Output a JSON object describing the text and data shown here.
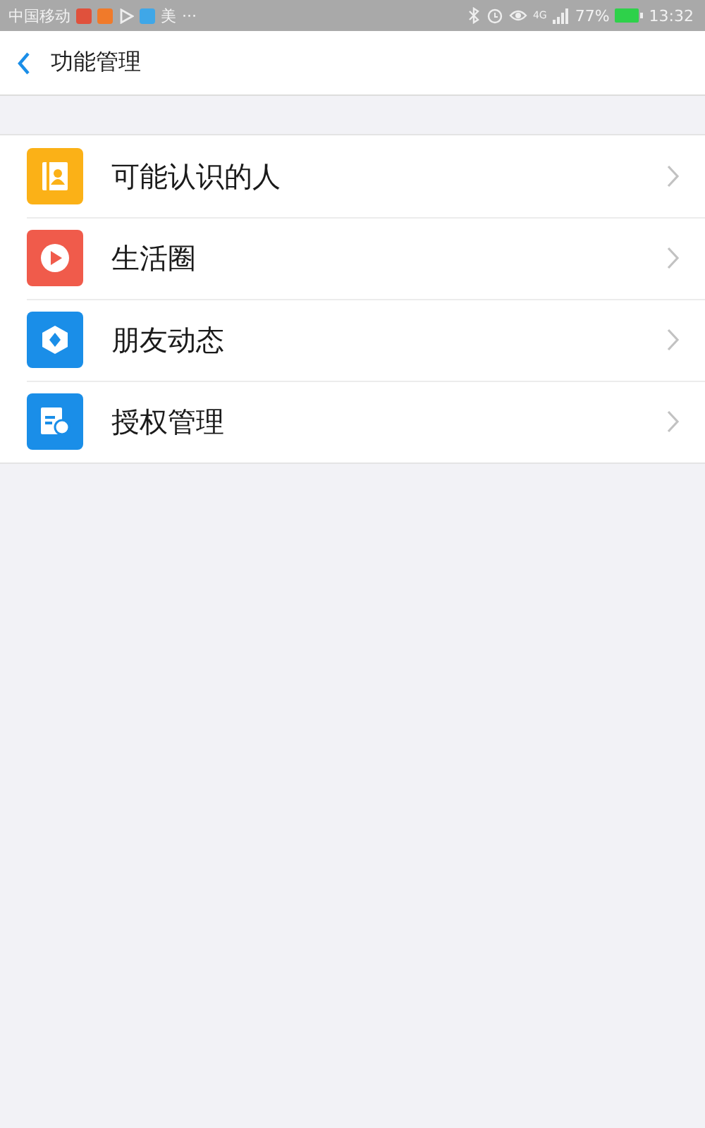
{
  "status_bar": {
    "carrier": "中国移动",
    "notice": "美",
    "more": "···",
    "network": "4G",
    "battery": "77%",
    "time": "13:32"
  },
  "header": {
    "title": "功能管理"
  },
  "items": [
    {
      "label": "可能认识的人",
      "kind": "contacts",
      "color": "#fbb117"
    },
    {
      "label": "生活圈",
      "kind": "video",
      "color": "#f05b4b"
    },
    {
      "label": "朋友动态",
      "kind": "shutter",
      "color": "#1a8ee8"
    },
    {
      "label": "授权管理",
      "kind": "certificate",
      "color": "#1a8ee8"
    }
  ]
}
